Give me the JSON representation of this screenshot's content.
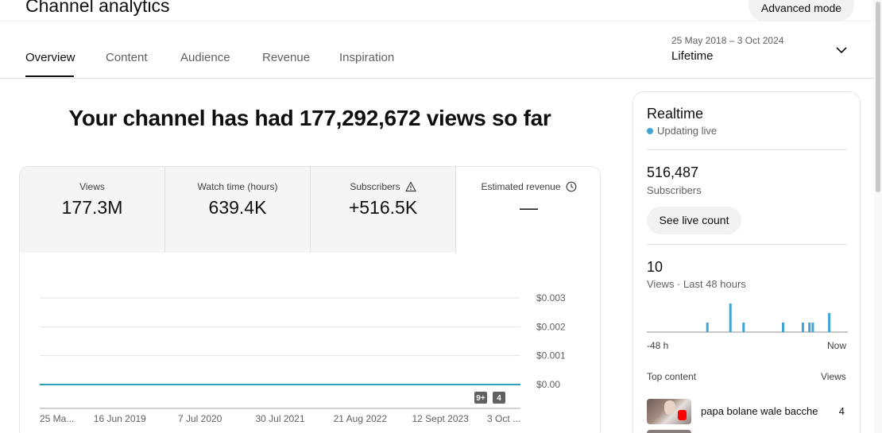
{
  "header": {
    "title": "Channel analytics",
    "advanced_mode_label": "Advanced mode"
  },
  "tabs": [
    {
      "label": "Overview",
      "active": true
    },
    {
      "label": "Content",
      "active": false
    },
    {
      "label": "Audience",
      "active": false
    },
    {
      "label": "Revenue",
      "active": false
    },
    {
      "label": "Inspiration",
      "active": false
    }
  ],
  "date_picker": {
    "range": "25 May 2018 – 3 Oct 2024",
    "label": "Lifetime"
  },
  "headline": "Your channel has had 177,292,672 views so far",
  "metrics": [
    {
      "label": "Views",
      "value": "177.3M",
      "icon": ""
    },
    {
      "label": "Watch time (hours)",
      "value": "639.4K",
      "icon": ""
    },
    {
      "label": "Subscribers",
      "value": "+516.5K",
      "icon": "warning-icon"
    },
    {
      "label": "Estimated revenue",
      "value": "—",
      "icon": "clock-icon"
    }
  ],
  "chart_data": {
    "type": "line",
    "series": [
      {
        "values": [
          0,
          0,
          0,
          0,
          0,
          0,
          0
        ]
      }
    ],
    "x": [
      "25 Ma...",
      "16 Jun 2019",
      "7 Jul 2020",
      "30 Jul 2021",
      "21 Aug 2022",
      "12 Sept 2023",
      "3 Oct ..."
    ],
    "y_ticks": [
      "$0.003",
      "$0.002",
      "$0.001",
      "$0.00"
    ],
    "ylim": [
      0,
      0.003
    ],
    "badges": [
      "9+",
      "4"
    ],
    "colors": {
      "line": "#2ba1b7",
      "grid": "#e5e5e5"
    }
  },
  "realtime": {
    "title": "Realtime",
    "status": "Updating live",
    "subscribers_value": "516,487",
    "subscribers_label": "Subscribers",
    "live_count_button": "See live count",
    "views_value": "10",
    "views_label": "Views · Last 48 hours",
    "bars_last_48h": [
      0,
      0,
      0,
      0,
      0,
      0,
      0,
      0,
      0,
      0,
      0,
      0,
      0,
      0,
      0,
      0,
      0,
      0,
      1,
      0,
      0,
      0,
      0,
      0,
      0,
      3,
      0,
      0,
      0,
      1,
      0,
      0,
      0,
      0,
      0,
      0,
      0,
      0,
      0,
      0,
      0,
      1,
      0,
      0,
      0,
      0,
      0,
      1,
      0,
      1,
      1,
      0,
      0,
      0,
      0,
      2,
      0,
      0,
      0,
      0,
      0
    ],
    "axis_start": "-48 h",
    "axis_end": "Now",
    "top_content_label": "Top content",
    "top_content_views_label": "Views",
    "top_content": [
      {
        "title": "papa bolane wale bacche",
        "views": "4"
      }
    ]
  },
  "colors": {
    "accent_live": "#41a4d5",
    "bar_color": "#41a4d5"
  }
}
